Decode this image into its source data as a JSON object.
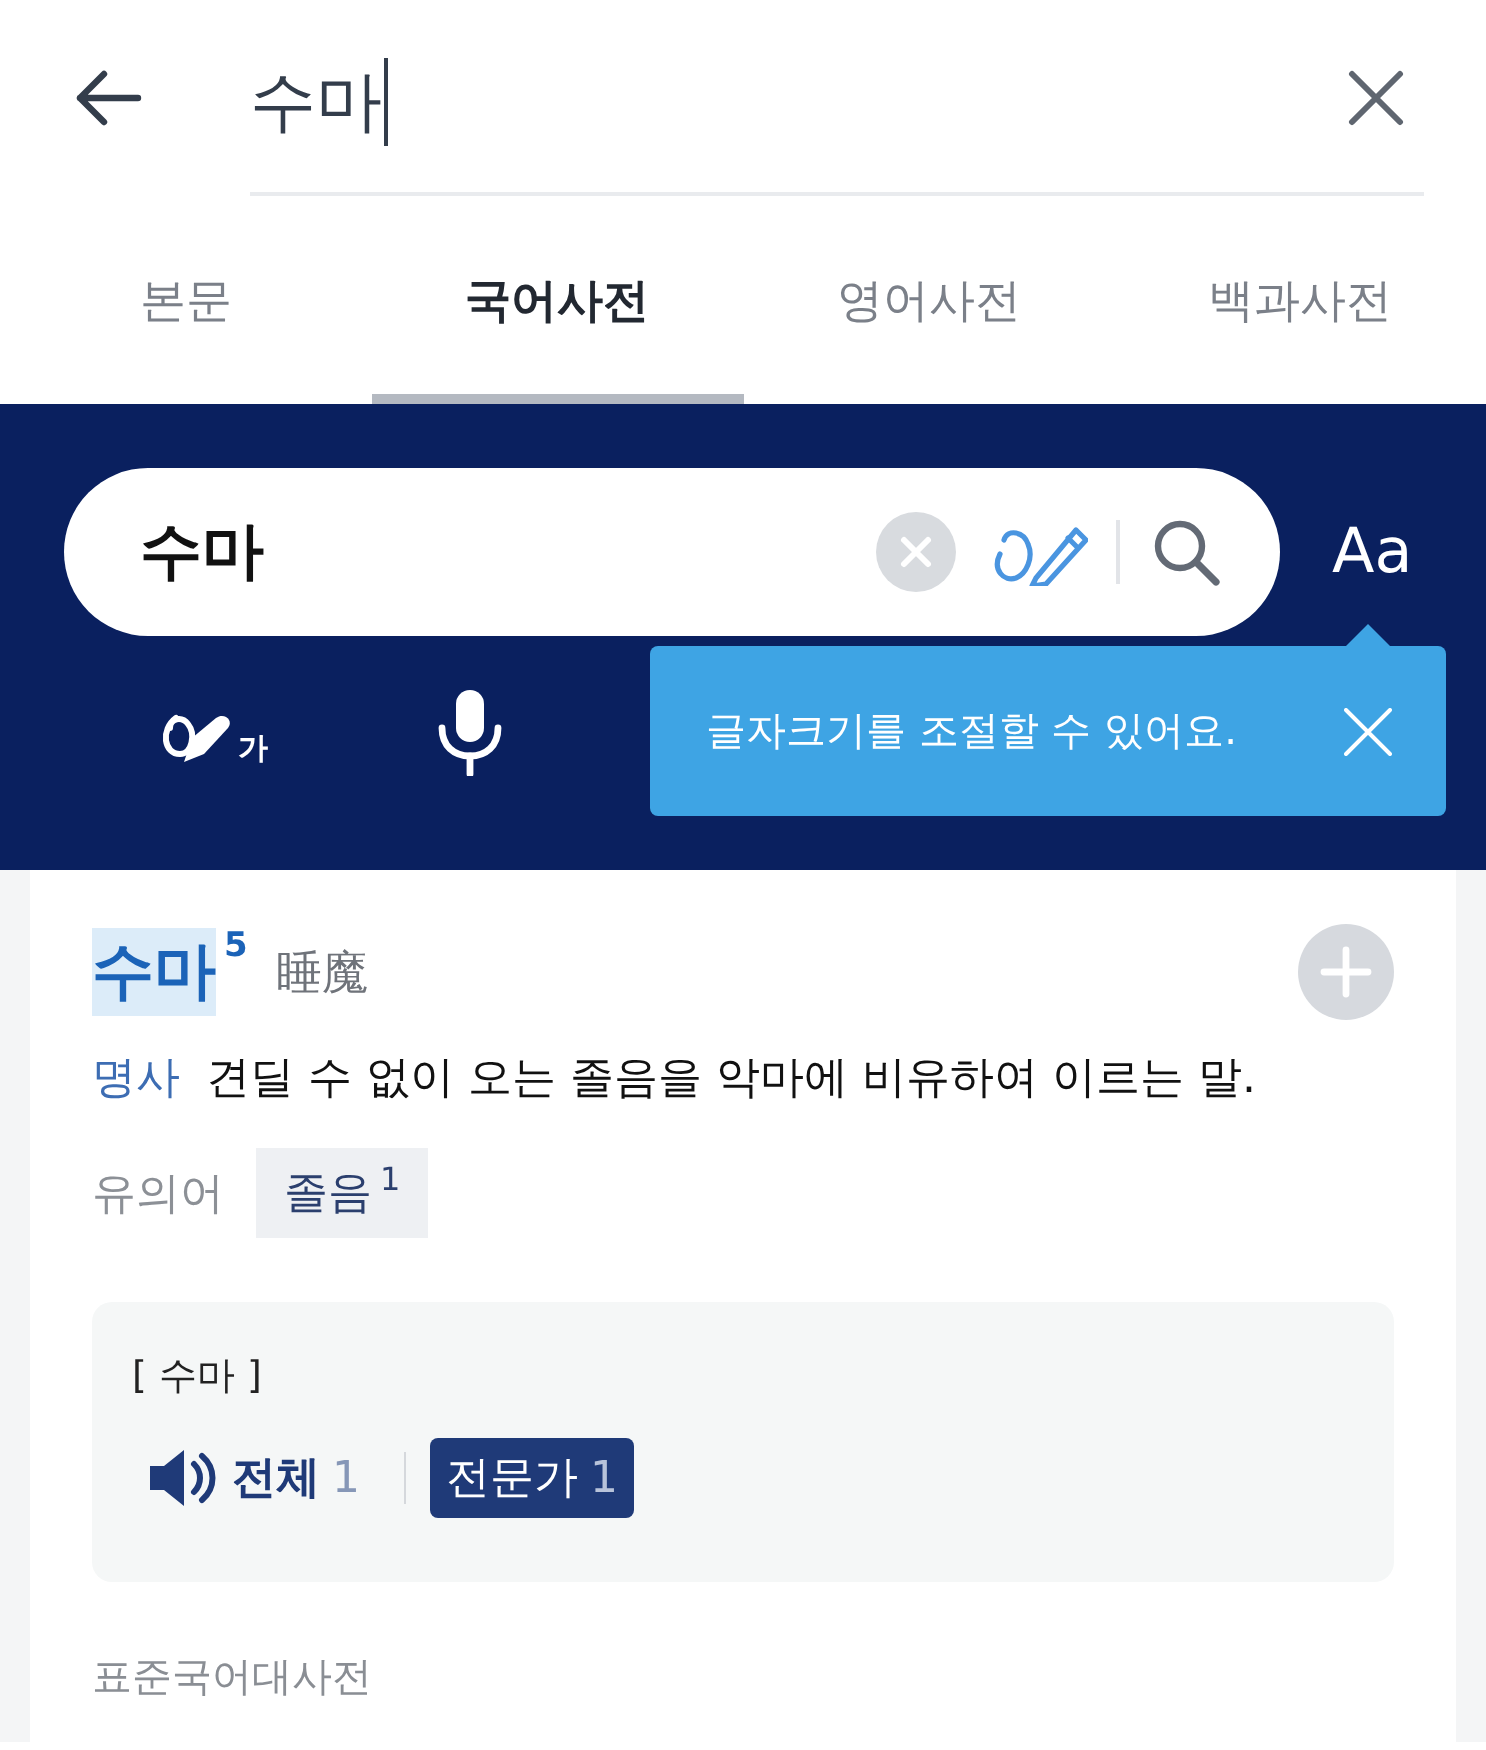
{
  "top_search": {
    "value": "수마",
    "focused": true
  },
  "tabs": [
    {
      "label": "본문",
      "selected": false
    },
    {
      "label": "국어사전",
      "selected": true
    },
    {
      "label": "영어사전",
      "selected": false
    },
    {
      "label": "백과사전",
      "selected": false
    }
  ],
  "search_panel": {
    "query": "수마",
    "font_size_button": "Aa",
    "handwriting_button": "가",
    "tooltip": {
      "text": "글자크기를 조절할 수 있어요."
    }
  },
  "entry": {
    "headword": "수마",
    "highlighted": true,
    "homonym_number": "5",
    "hanja": "睡魔",
    "part_of_speech": "명사",
    "definition": "견딜 수 없이 오는 졸음을 악마에 비유하여 이르는 말.",
    "synonym_label": "유의어",
    "synonyms": [
      {
        "word": "졸음",
        "number": "1"
      }
    ],
    "pronunciation": {
      "text": "[ 수마 ]",
      "buttons": [
        {
          "kind": "play",
          "label": "전체",
          "count": "1",
          "selected": false
        },
        {
          "kind": "filter",
          "label": "전문가",
          "count": "1",
          "selected": true
        }
      ]
    },
    "source": "표준국어대사전"
  }
}
